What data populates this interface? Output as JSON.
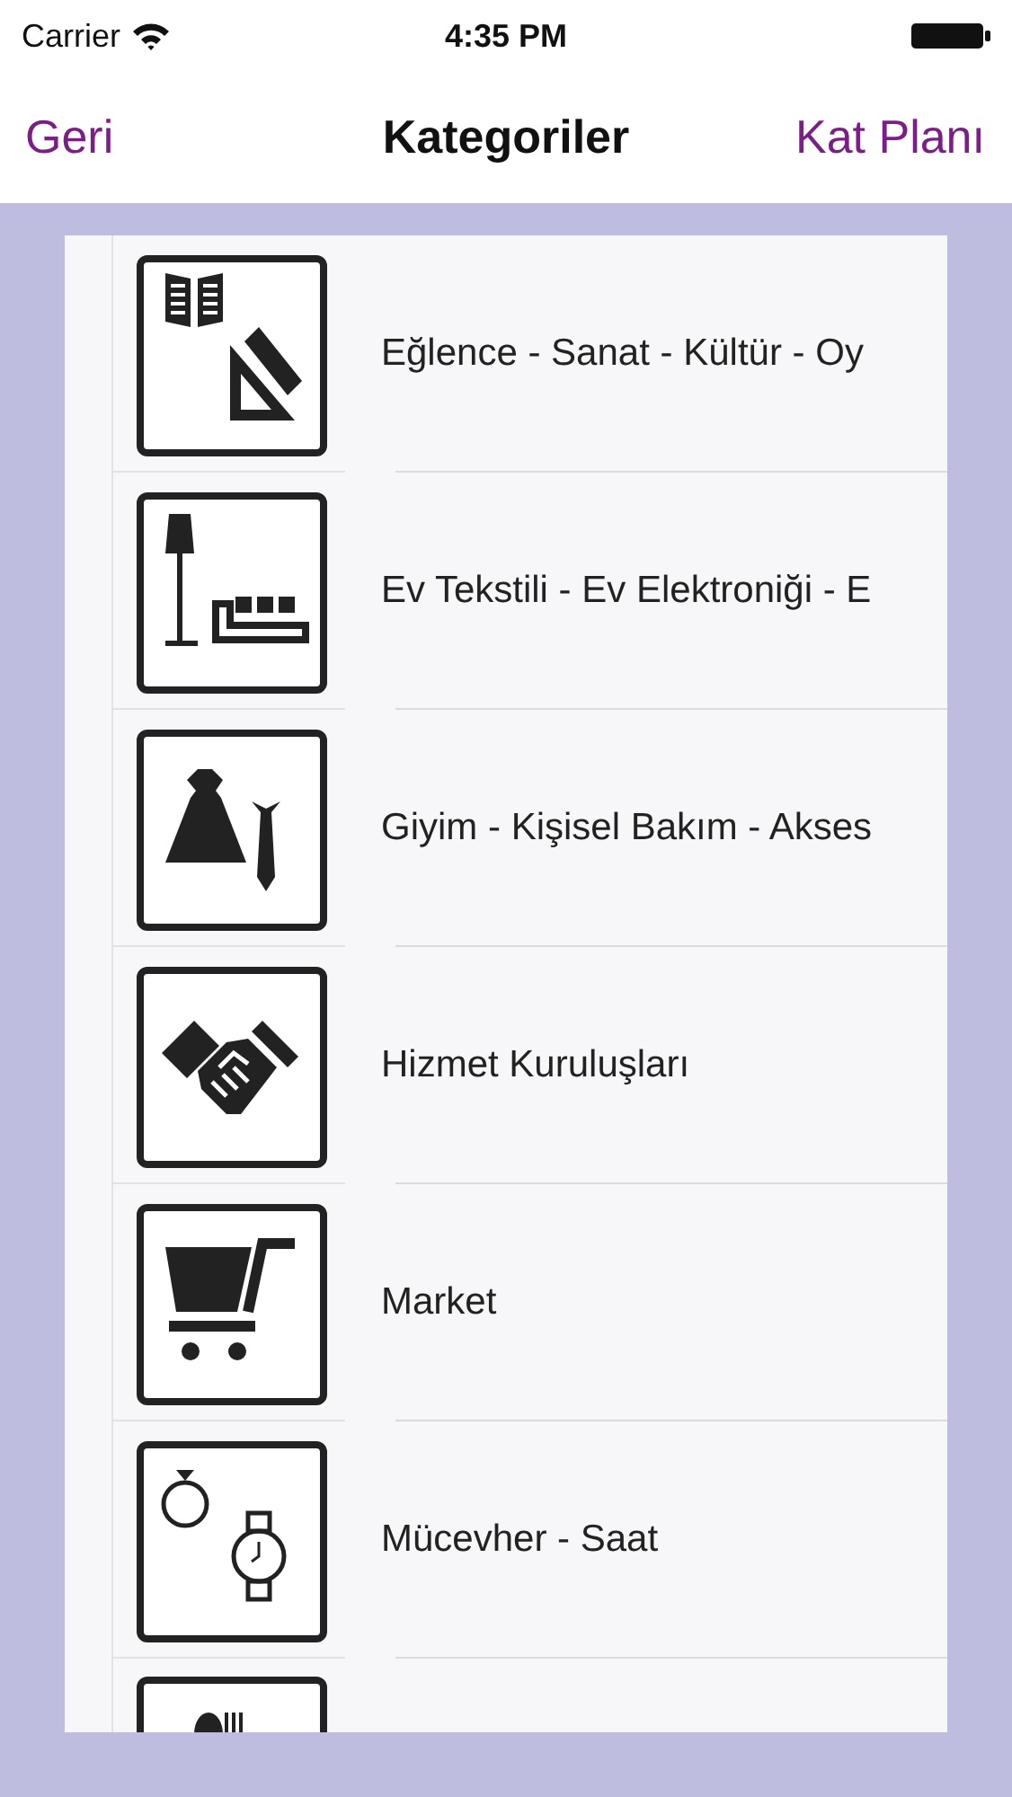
{
  "status_bar": {
    "carrier": "Carrier",
    "time": "4:35 PM"
  },
  "nav": {
    "back": "Geri",
    "title": "Kategoriler",
    "action": "Kat Planı"
  },
  "rows": [
    {
      "kind": "category",
      "label": "Eğlence - Sanat - Kültür - Oy"
    },
    {
      "kind": "category",
      "label": "Ev Tekstili - Ev Elektroniği - E"
    },
    {
      "kind": "category",
      "label": "Giyim - Kişisel Bakım - Akses"
    },
    {
      "kind": "category",
      "label": "Hizmet Kuruluşları"
    },
    {
      "kind": "category",
      "label": "Market"
    },
    {
      "kind": "category",
      "label": "Mücevher - Saat"
    },
    {
      "kind": "partial"
    }
  ]
}
